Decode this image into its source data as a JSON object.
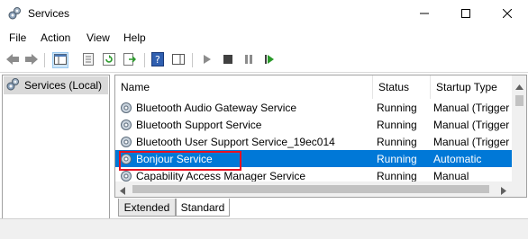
{
  "window": {
    "title": "Services"
  },
  "menu": {
    "file": "File",
    "action": "Action",
    "view": "View",
    "help": "Help"
  },
  "tree": {
    "root": "Services (Local)"
  },
  "columns": {
    "name": "Name",
    "status": "Status",
    "startup_type": "Startup Type"
  },
  "rows": [
    {
      "name": "Bluetooth Audio Gateway Service",
      "status": "Running",
      "startup": "Manual (Trigger"
    },
    {
      "name": "Bluetooth Support Service",
      "status": "Running",
      "startup": "Manual (Trigger"
    },
    {
      "name": "Bluetooth User Support Service_19ec014",
      "status": "Running",
      "startup": "Manual (Trigger"
    },
    {
      "name": "Bonjour Service",
      "status": "Running",
      "startup": "Automatic"
    },
    {
      "name": "Capability Access Manager Service",
      "status": "Running",
      "startup": "Manual"
    }
  ],
  "tabs": {
    "extended": "Extended",
    "standard": "Standard"
  },
  "colors": {
    "selection": "#0078d7",
    "highlight": "#e81123"
  }
}
